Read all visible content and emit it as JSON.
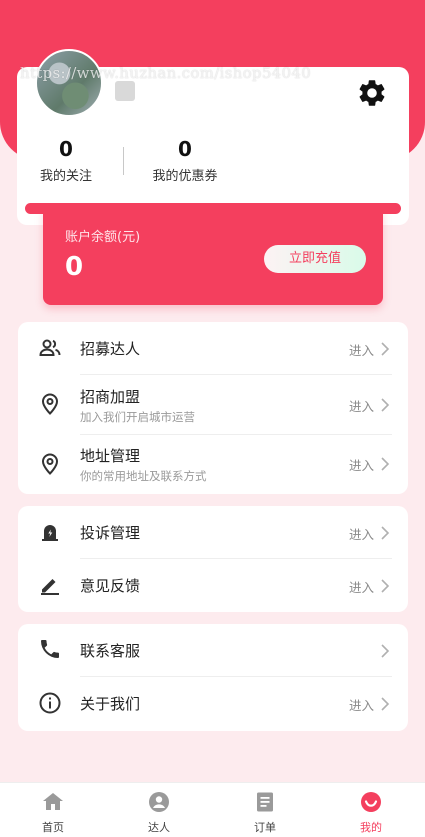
{
  "profile": {
    "username": "…",
    "watermark": "https://www.huzhan.com/ishop54040",
    "stats": [
      {
        "value": "0",
        "label": "我的关注"
      },
      {
        "value": "0",
        "label": "我的优惠券"
      }
    ]
  },
  "balance": {
    "label": "账户余额(元)",
    "amount": "0",
    "recharge_label": "立即充值"
  },
  "menu_groups": [
    {
      "items": [
        {
          "icon": "users-icon",
          "title": "招募达人",
          "subtitle": "",
          "enter": "进入"
        },
        {
          "icon": "location-pin-icon",
          "title": "招商加盟",
          "subtitle": "加入我们开启城市运营",
          "enter": "进入"
        },
        {
          "icon": "location-pin-icon",
          "title": "地址管理",
          "subtitle": "你的常用地址及联系方式",
          "enter": "进入"
        }
      ]
    },
    {
      "items": [
        {
          "icon": "alarm-icon",
          "title": "投诉管理",
          "subtitle": "",
          "enter": "进入"
        },
        {
          "icon": "pencil-icon",
          "title": "意见反馈",
          "subtitle": "",
          "enter": "进入"
        }
      ]
    },
    {
      "items": [
        {
          "icon": "phone-icon",
          "title": "联系客服",
          "subtitle": "",
          "enter": ""
        },
        {
          "icon": "info-icon",
          "title": "关于我们",
          "subtitle": "",
          "enter": "进入"
        }
      ]
    }
  ],
  "tabbar": {
    "active_color": "#f43f5e",
    "tabs": [
      {
        "label": "首页",
        "icon": "home-icon",
        "active": false
      },
      {
        "label": "达人",
        "icon": "person-icon",
        "active": false
      },
      {
        "label": "订单",
        "icon": "document-icon",
        "active": false
      },
      {
        "label": "我的",
        "icon": "smile-icon",
        "active": true
      }
    ]
  },
  "colors": {
    "accent": "#f43f5e",
    "background": "#fdebee"
  }
}
